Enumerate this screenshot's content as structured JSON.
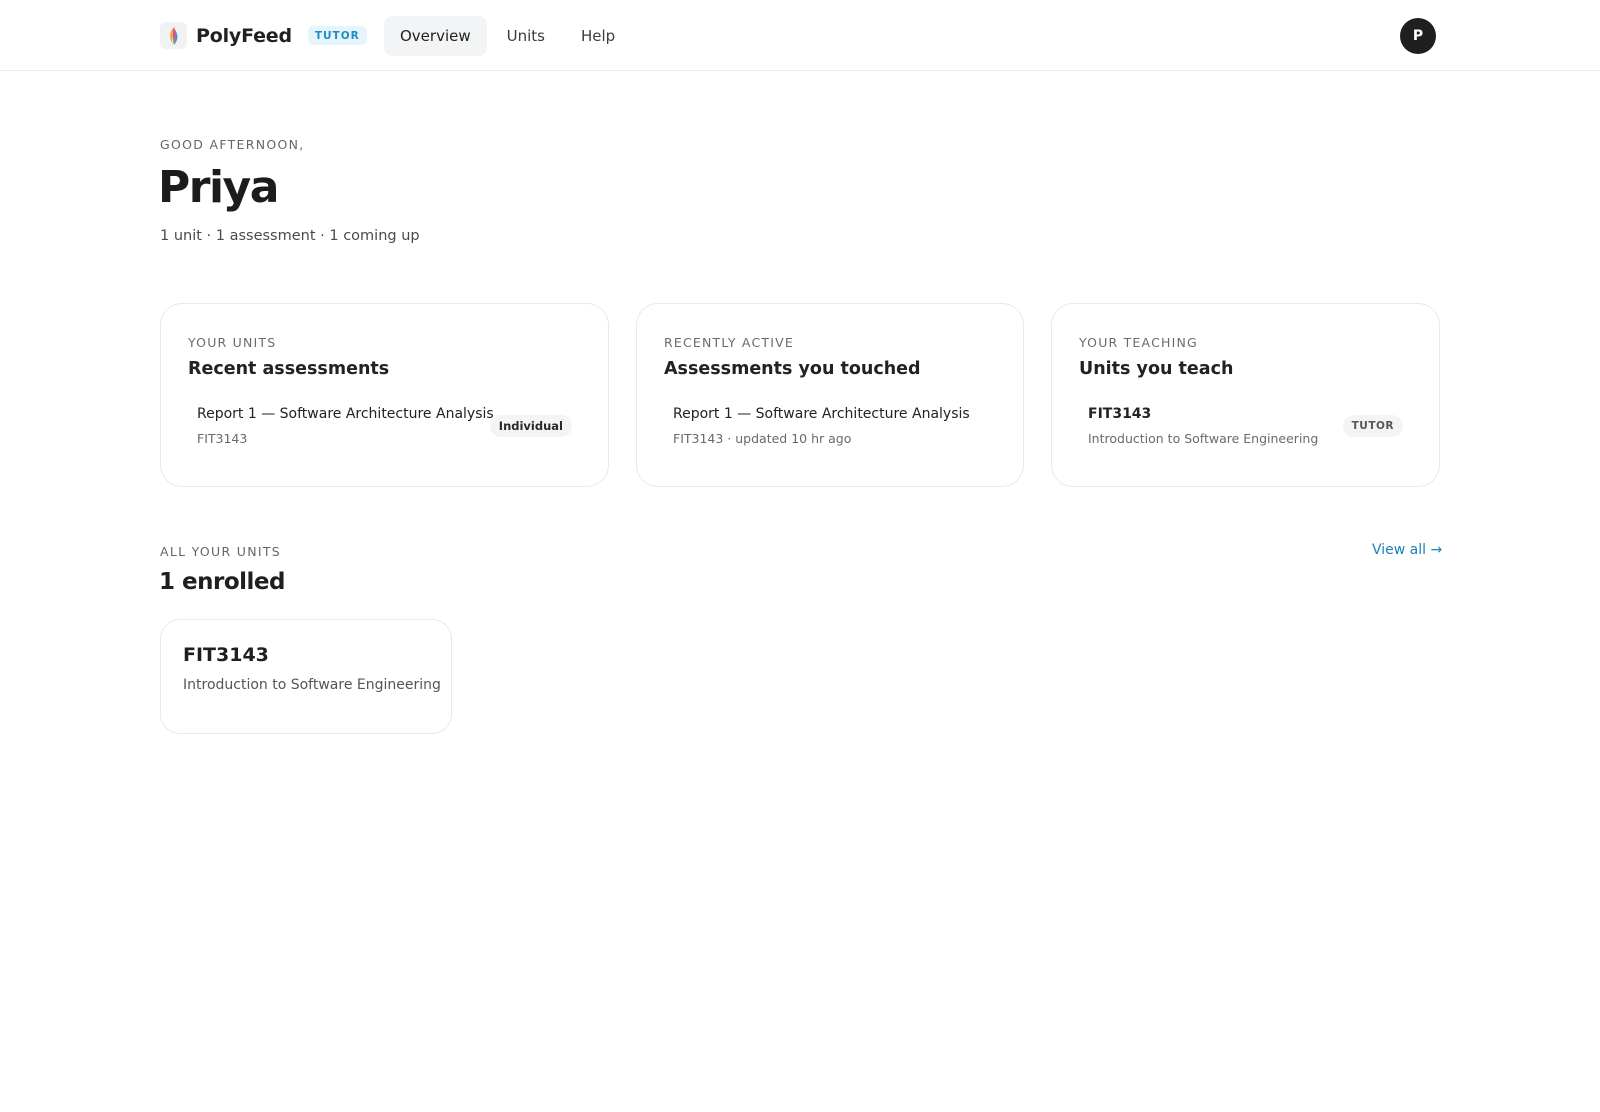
{
  "app": {
    "name": "PolyFeed",
    "role_badge": "TUTOR",
    "logo_icon": "polyfeed-logo-icon"
  },
  "nav": {
    "items": [
      {
        "label": "Overview",
        "active": true
      },
      {
        "label": "Units",
        "active": false
      },
      {
        "label": "Help",
        "active": false
      }
    ]
  },
  "user": {
    "avatar_initial": "P"
  },
  "greeting": {
    "eyebrow": "GOOD AFTERNOON,",
    "name": "Priya",
    "summary": "1 unit · 1 assessment · 1 coming up"
  },
  "cards": {
    "recent_assessments": {
      "eyebrow": "YOUR UNITS",
      "title": "Recent assessments",
      "items": [
        {
          "title": "Report 1 — Software Architecture Analysis",
          "subtitle": "FIT3143",
          "badge": "Individual"
        }
      ]
    },
    "recently_active": {
      "eyebrow": "RECENTLY ACTIVE",
      "title": "Assessments you touched",
      "items": [
        {
          "title": "Report 1 — Software Architecture Analysis",
          "subtitle": "FIT3143 · updated 10 hr ago"
        }
      ]
    },
    "teaching": {
      "eyebrow": "YOUR TEACHING",
      "title": "Units you teach",
      "items": [
        {
          "code": "FIT3143",
          "name": "Introduction to Software Engineering",
          "role": "TUTOR"
        }
      ]
    }
  },
  "all_units": {
    "eyebrow": "ALL YOUR UNITS",
    "title": "1 enrolled",
    "view_all": "View all →",
    "units": [
      {
        "code": "FIT3143",
        "name": "Introduction to Software Engineering"
      }
    ]
  },
  "colors": {
    "accent": "#1b84b8",
    "badge_bg": "#e6f4fb",
    "text_primary": "#1f1f1f",
    "border": "#e9e9e9"
  }
}
